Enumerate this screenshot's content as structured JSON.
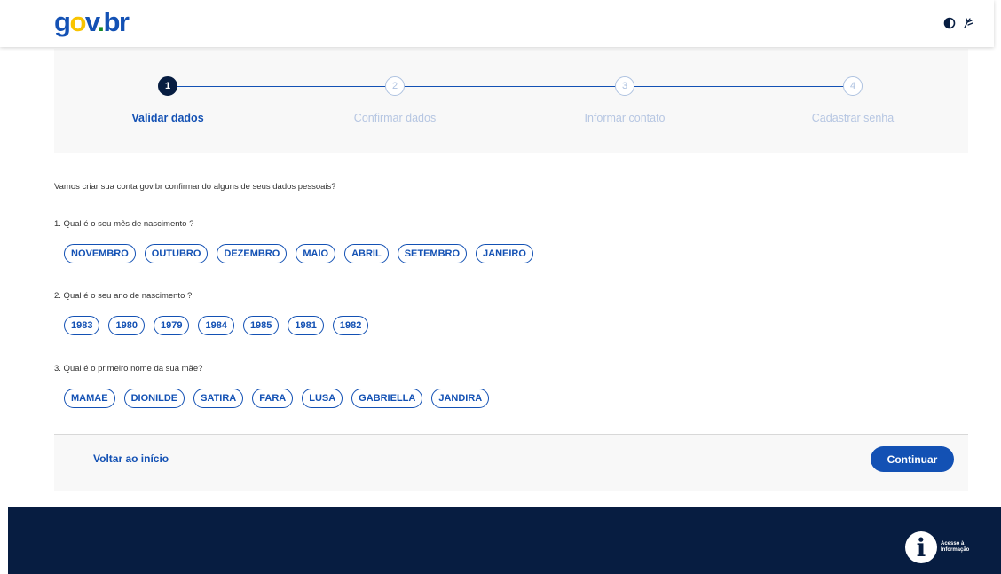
{
  "header": {
    "logo_g": "g",
    "logo_o": "o",
    "logo_v": "v",
    "logo_dot": ".",
    "logo_br": "br",
    "icons": [
      "contrast-icon",
      "libras-hand-icon"
    ]
  },
  "stepper": {
    "steps": [
      {
        "number": "1",
        "label": "Validar dados",
        "active": true
      },
      {
        "number": "2",
        "label": "Confirmar dados",
        "active": false
      },
      {
        "number": "3",
        "label": "Informar contato",
        "active": false
      },
      {
        "number": "4",
        "label": "Cadastrar senha",
        "active": false
      }
    ]
  },
  "intro": "Vamos criar sua conta gov.br confirmando alguns de seus dados pessoais?",
  "questions": [
    {
      "text": "1. Qual é o seu mês de nascimento ?",
      "options": [
        "NOVEMBRO",
        "OUTUBRO",
        "DEZEMBRO",
        "MAIO",
        "ABRIL",
        "SETEMBRO",
        "JANEIRO"
      ]
    },
    {
      "text": "2. Qual é o seu ano de nascimento ?",
      "options": [
        "1983",
        "1980",
        "1979",
        "1984",
        "1985",
        "1981",
        "1982"
      ]
    },
    {
      "text": "3. Qual é o primeiro nome da sua mãe?",
      "options": [
        "MAMAE",
        "DIONILDE",
        "SATIRA",
        "FARA",
        "LUSA",
        "GABRIELLA",
        "JANDIRA"
      ]
    }
  ],
  "actions": {
    "back_label": "Voltar ao início",
    "continue_label": "Continuar"
  },
  "footer": {
    "badge_letter": "i",
    "badge_line1": "Acesso à",
    "badge_line2": "Informação"
  },
  "colors": {
    "primary": "#1351b4",
    "dark_blue": "#071d41",
    "panel_bg": "#f8f8f8",
    "inactive_step": "#b6c6e2"
  }
}
